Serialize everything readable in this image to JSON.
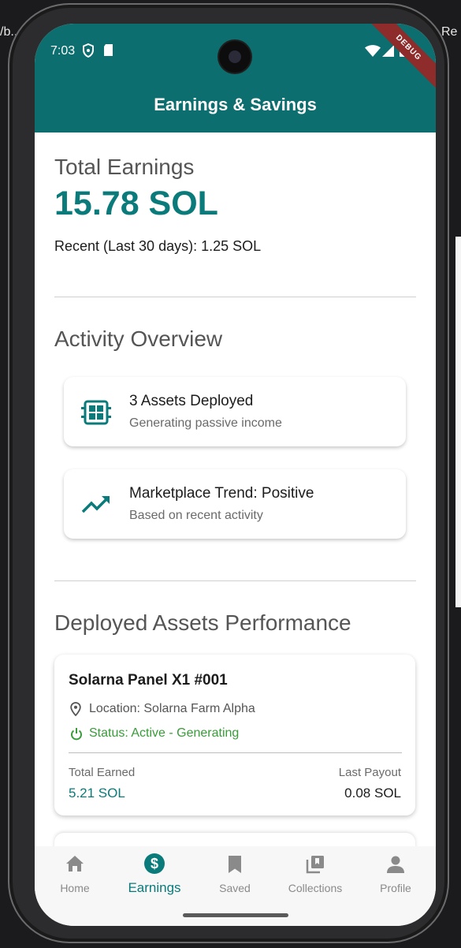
{
  "status_bar": {
    "time": "7:03"
  },
  "debug_banner": "DEBUG",
  "app_bar": {
    "title": "Earnings & Savings"
  },
  "background": {
    "fragment_left": "/b...",
    "fragment_right": "Re"
  },
  "earnings": {
    "heading": "Total Earnings",
    "amount": "15.78 SOL",
    "recent": "Recent (Last 30 days): 1.25 SOL"
  },
  "activity": {
    "heading": "Activity Overview",
    "cards": [
      {
        "icon": "chip-icon",
        "title": "3 Assets Deployed",
        "subtitle": "Generating passive income"
      },
      {
        "icon": "trending-up-icon",
        "title": "Marketplace Trend: Positive",
        "subtitle": "Based on recent activity"
      }
    ]
  },
  "performance": {
    "heading": "Deployed Assets Performance",
    "assets": [
      {
        "name": "Solarna Panel X1 #001",
        "location": "Location: Solarna Farm Alpha",
        "status": "Status: Active - Generating",
        "total_earned_label": "Total Earned",
        "total_earned": "5.21 SOL",
        "last_payout_label": "Last Payout",
        "last_payout": "0.08 SOL"
      }
    ]
  },
  "bottom_nav": {
    "items": [
      {
        "label": "Home",
        "icon": "home-icon"
      },
      {
        "label": "Earnings",
        "icon": "dollar-circle-icon",
        "active": true
      },
      {
        "label": "Saved",
        "icon": "bookmark-icon"
      },
      {
        "label": "Collections",
        "icon": "collections-icon"
      },
      {
        "label": "Profile",
        "icon": "person-icon"
      }
    ]
  },
  "colors": {
    "primary": "#0c6e6e",
    "accent_text": "#0b7a7a",
    "status_green": "#3a9b3a",
    "debug_red": "#8e2b2b"
  }
}
